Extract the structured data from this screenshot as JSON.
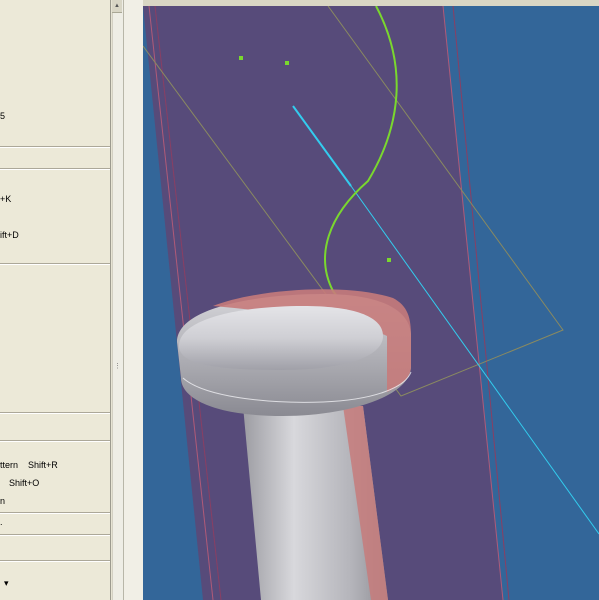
{
  "menu": {
    "items": [
      {
        "text": "5"
      },
      {
        "text": "+K"
      },
      {
        "text": "ift+D"
      },
      {
        "text": "ttern",
        "shortcut": "Shift+R"
      },
      {
        "text": "",
        "shortcut": "Shift+O"
      },
      {
        "text": "n"
      },
      {
        "text": "."
      },
      {
        "text": "▾"
      }
    ]
  },
  "scrollbar": {
    "up_arrow": "▲",
    "grip": "⋮"
  },
  "viewport": {
    "background_color": "#336699",
    "plane_color": "#5a4a78",
    "screw_color": "#c8c8cc",
    "section_color": "#c77b7b",
    "curve_color": "#7ad82e",
    "axis_color": "#33ccee"
  }
}
